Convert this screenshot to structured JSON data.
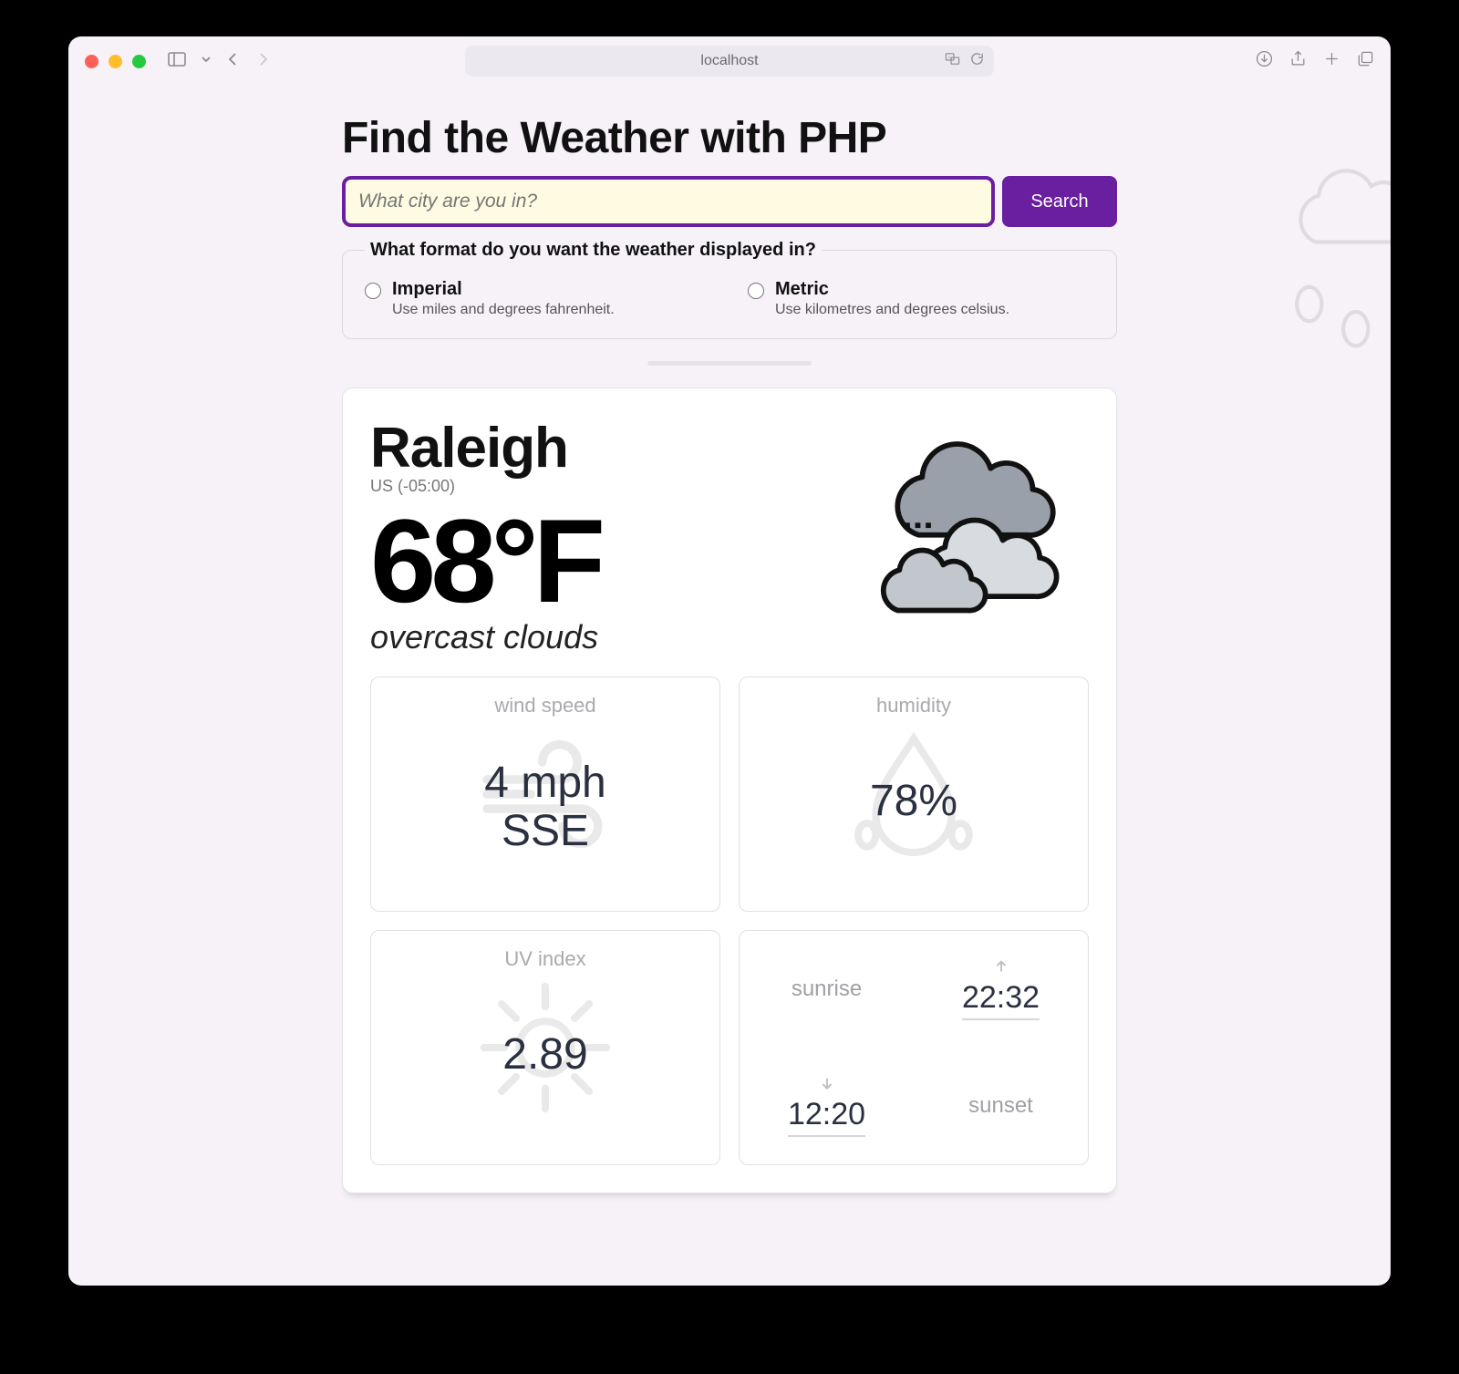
{
  "browser": {
    "url": "localhost"
  },
  "page": {
    "title": "Find the Weather with PHP",
    "search": {
      "placeholder": "What city are you in?",
      "button": "Search"
    },
    "format": {
      "legend": "What format do you want the weather displayed in?",
      "options": [
        {
          "label": "Imperial",
          "desc": "Use miles and degrees fahrenheit."
        },
        {
          "label": "Metric",
          "desc": "Use kilometres and degrees celsius."
        }
      ]
    }
  },
  "weather": {
    "city": "Raleigh",
    "region": "US (-05:00)",
    "temperature": "68°F",
    "condition": "overcast clouds",
    "metrics": {
      "wind": {
        "label": "wind speed",
        "value": "4 mph",
        "dir": "SSE"
      },
      "humidity": {
        "label": "humidity",
        "value": "78%"
      },
      "uv": {
        "label": "UV index",
        "value": "2.89"
      },
      "sun": {
        "sunrise_label": "sunrise",
        "sunrise": "22:32",
        "sunset_label": "sunset",
        "sunset": "12:20"
      }
    }
  }
}
